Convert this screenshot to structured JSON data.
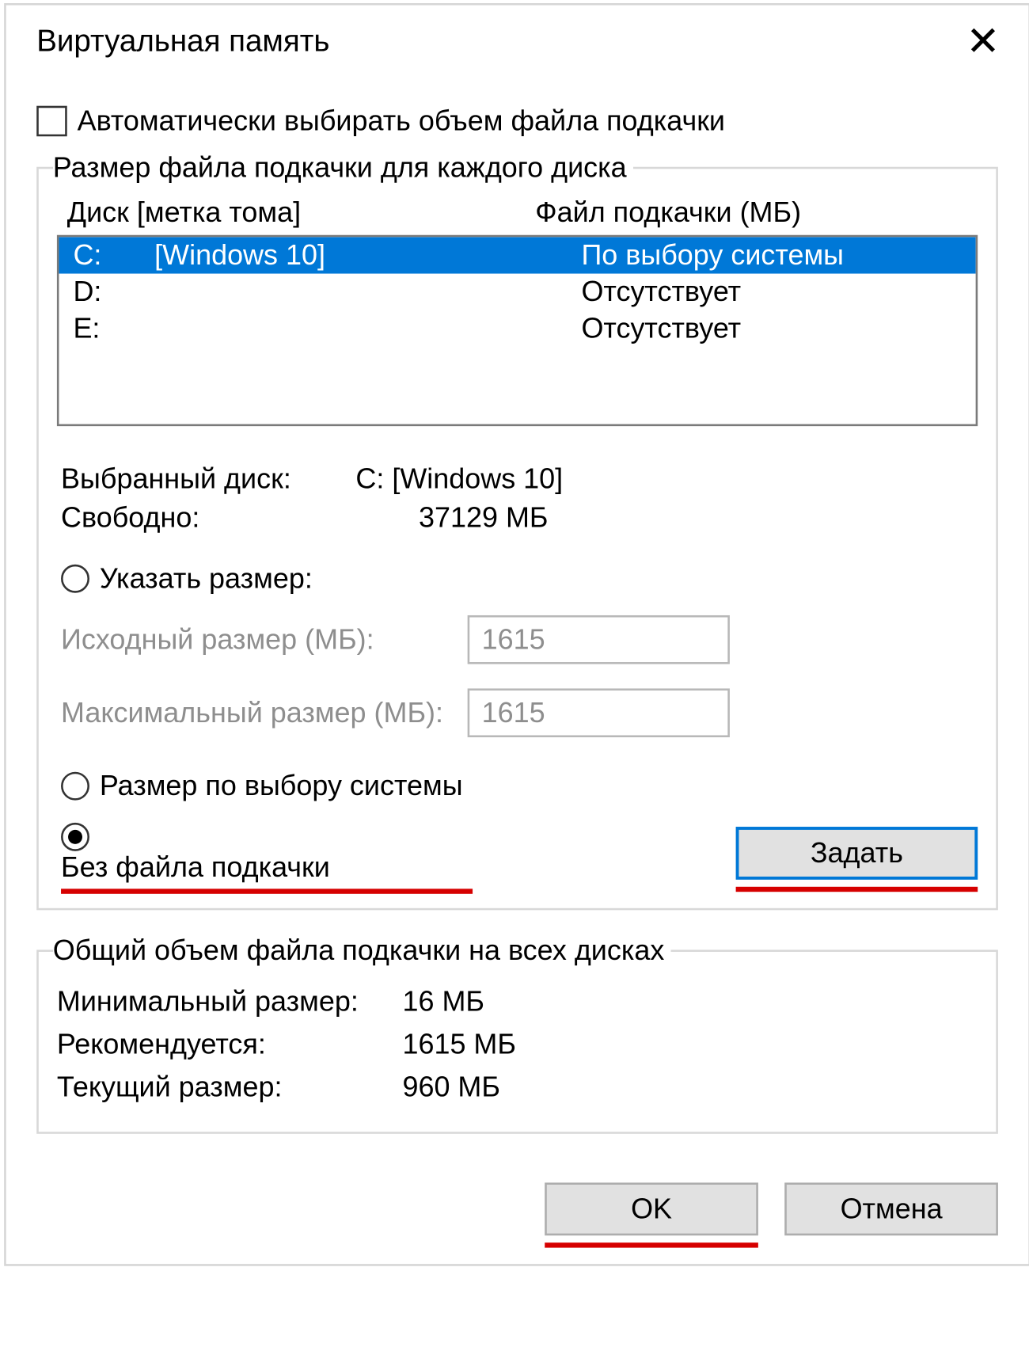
{
  "window": {
    "title": "Виртуальная память",
    "close_icon": "✕"
  },
  "auto_manage": {
    "label": "Автоматически выбирать объем файла подкачки",
    "checked": false
  },
  "drive_group": {
    "legend": "Размер файла подкачки для каждого диска",
    "header_drive": "Диск [метка тома]",
    "header_paging": "Файл подкачки (МБ)",
    "rows": [
      {
        "letter": "C:",
        "label": "[Windows 10]",
        "status": "По выбору системы",
        "selected": true
      },
      {
        "letter": "D:",
        "label": "",
        "status": "Отсутствует",
        "selected": false
      },
      {
        "letter": "E:",
        "label": "",
        "status": "Отсутствует",
        "selected": false
      }
    ],
    "selected_drive_label": "Выбранный диск:",
    "selected_drive_value": "C:  [Windows 10]",
    "free_label": "Свободно:",
    "free_value": "37129 МБ",
    "radio_custom": "Указать размер:",
    "initial_size_label": "Исходный размер (МБ):",
    "initial_size_value": "1615",
    "max_size_label": "Максимальный размер (МБ):",
    "max_size_value": "1615",
    "radio_system": "Размер по выбору системы",
    "radio_nopage": "Без файла подкачки",
    "set_button": "Задать"
  },
  "totals_group": {
    "legend": "Общий объем файла подкачки на всех дисках",
    "min_label": "Минимальный размер:",
    "min_value": "16 МБ",
    "rec_label": "Рекомендуется:",
    "rec_value": "1615 МБ",
    "cur_label": "Текущий размер:",
    "cur_value": "960 МБ"
  },
  "buttons": {
    "ok": "OK",
    "cancel": "Отмена"
  }
}
